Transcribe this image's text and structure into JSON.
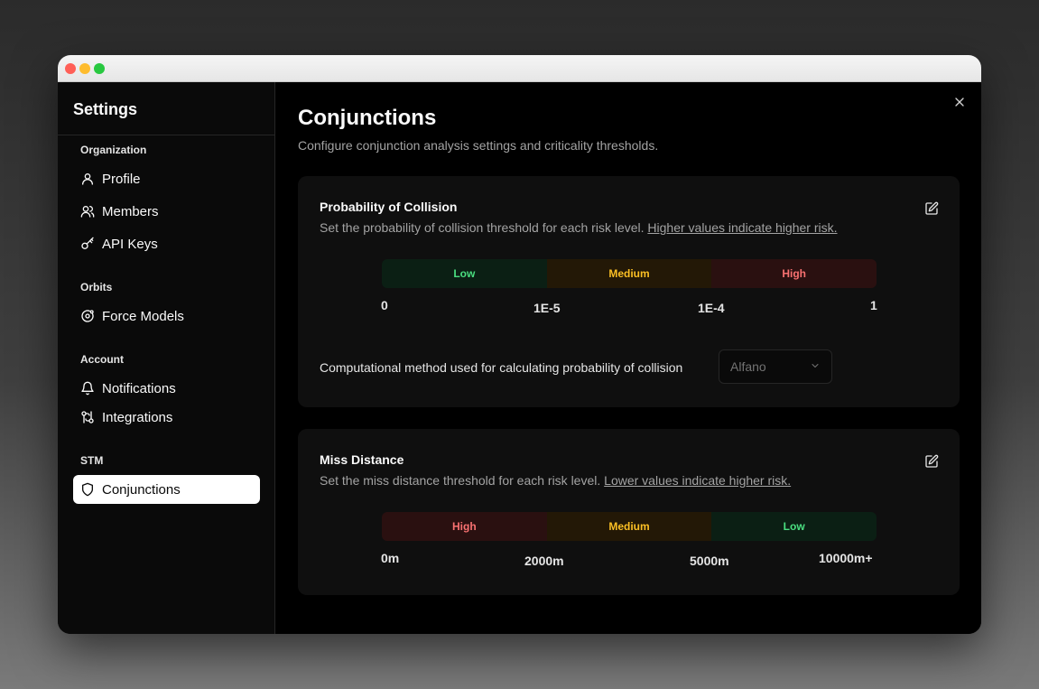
{
  "sidebar": {
    "title": "Settings",
    "sections": [
      {
        "label": "Organization",
        "items": [
          {
            "label": "Profile",
            "icon": "user-icon"
          },
          {
            "label": "Members",
            "icon": "users-icon"
          },
          {
            "label": "API Keys",
            "icon": "key-icon"
          }
        ]
      },
      {
        "label": "Orbits",
        "items": [
          {
            "label": "Force Models",
            "icon": "orbit-icon"
          }
        ]
      },
      {
        "label": "Account",
        "items": [
          {
            "label": "Notifications",
            "icon": "bell-icon"
          },
          {
            "label": "Integrations",
            "icon": "integrations-icon"
          }
        ]
      },
      {
        "label": "STM",
        "items": [
          {
            "label": "Conjunctions",
            "icon": "shield-icon",
            "active": true
          }
        ]
      }
    ]
  },
  "main": {
    "title": "Conjunctions",
    "subtitle": "Configure conjunction analysis settings and criticality thresholds.",
    "pc": {
      "title": "Probability of Collision",
      "description": "Set the probability of collision threshold for each risk level.",
      "link": "Higher values indicate higher risk.",
      "levels": [
        "Low",
        "Medium",
        "High"
      ],
      "ticks": [
        "0",
        "1E-5",
        "1E-4",
        "1"
      ],
      "method_label": "Computational method used for calculating probability of collision",
      "method_value": "Alfano"
    },
    "miss": {
      "title": "Miss Distance",
      "description": "Set the miss distance threshold for each risk level.",
      "link": "Lower values indicate higher risk.",
      "levels": [
        "High",
        "Medium",
        "Low"
      ],
      "ticks": [
        "0m",
        "2000m",
        "5000m",
        "10000m+"
      ]
    }
  },
  "colors": {
    "low": "#4ade80",
    "medium": "#fbbf24",
    "high": "#f87171"
  }
}
